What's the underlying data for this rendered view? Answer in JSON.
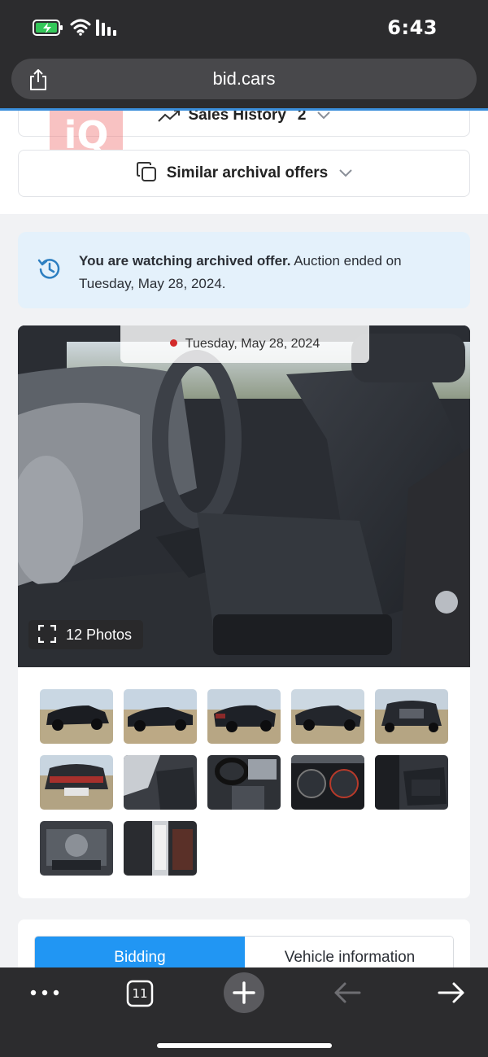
{
  "status_bar": {
    "time": "6:43"
  },
  "browser": {
    "url": "bid.cars",
    "open_tabs": "11"
  },
  "top_section": {
    "sales_history_label": "Sales History",
    "sales_history_count": "2",
    "similar_offers_label": "Similar archival offers",
    "watermark": "iQ"
  },
  "notice": {
    "bold_text": "You are watching archived offer.",
    "rest_text": " Auction ended on Tuesday, May 28, 2024."
  },
  "gallery": {
    "date": "Tuesday, May 28, 2024",
    "photos_count_label": "12 Photos",
    "thumbnails": [
      {
        "name": "thumb-exterior-front-left"
      },
      {
        "name": "thumb-exterior-side"
      },
      {
        "name": "thumb-exterior-rear"
      },
      {
        "name": "thumb-exterior-right"
      },
      {
        "name": "thumb-exterior-front"
      },
      {
        "name": "thumb-exterior-rear-damage"
      },
      {
        "name": "thumb-interior-front-seat"
      },
      {
        "name": "thumb-interior-console"
      },
      {
        "name": "thumb-instrument-cluster"
      },
      {
        "name": "thumb-interior-rear-seat"
      },
      {
        "name": "thumb-engine-bay"
      },
      {
        "name": "thumb-door-label"
      }
    ]
  },
  "tabs": {
    "bidding": "Bidding",
    "vehicle_info": "Vehicle information"
  },
  "colors": {
    "accent": "#2196f3",
    "notice_bg": "#e4f1fb",
    "status_dot": "#d32b2b"
  }
}
